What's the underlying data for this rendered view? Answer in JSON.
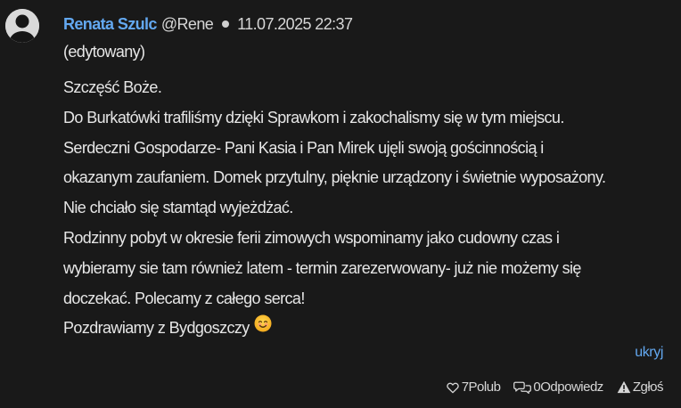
{
  "comment": {
    "author": {
      "name": "Renata Szulc",
      "handle": "@Rene",
      "avatar_icon": "user-avatar-icon"
    },
    "timestamp": "11.07.2025 22:37",
    "edited_label": "(edytowany)",
    "body_lines": [
      "Szczęść Boże.",
      "Do Burkatówki trafiliśmy dzięki Sprawkom i zakochalismy się w tym miejscu.",
      "Serdeczni Gospodarze- Pani Kasia i Pan Mirek ujęli swoją gościnnością i",
      "okazanym zaufaniem. Domek przytulny, pięknie urządzony i świetnie wyposażony.",
      "Nie chciało się stamtąd wyjeżdżać.",
      "Rodzinny pobyt w okresie ferii zimowych wspominamy jako cudowny czas i",
      "wybieramy sie tam również latem - termin zarezerwowany- już nie możemy się",
      "doczekać. Polecamy z całego serca!",
      "Pozdrawiamy z Bydgoszczy"
    ],
    "emoji_icon": "smiling-face-emoji-icon",
    "hide_label": "ukryj",
    "actions": {
      "like": {
        "count": "7",
        "label": "Polub",
        "icon": "heart-icon"
      },
      "reply": {
        "count": "0",
        "label": "Odpowiedz",
        "icon": "speech-bubbles-icon"
      },
      "report": {
        "label": "Zgłoś",
        "icon": "warning-triangle-icon"
      }
    }
  },
  "colors": {
    "background": "#191919",
    "text": "#e6e6e6",
    "link": "#63a8f0",
    "avatar": "#d9d9d9"
  }
}
